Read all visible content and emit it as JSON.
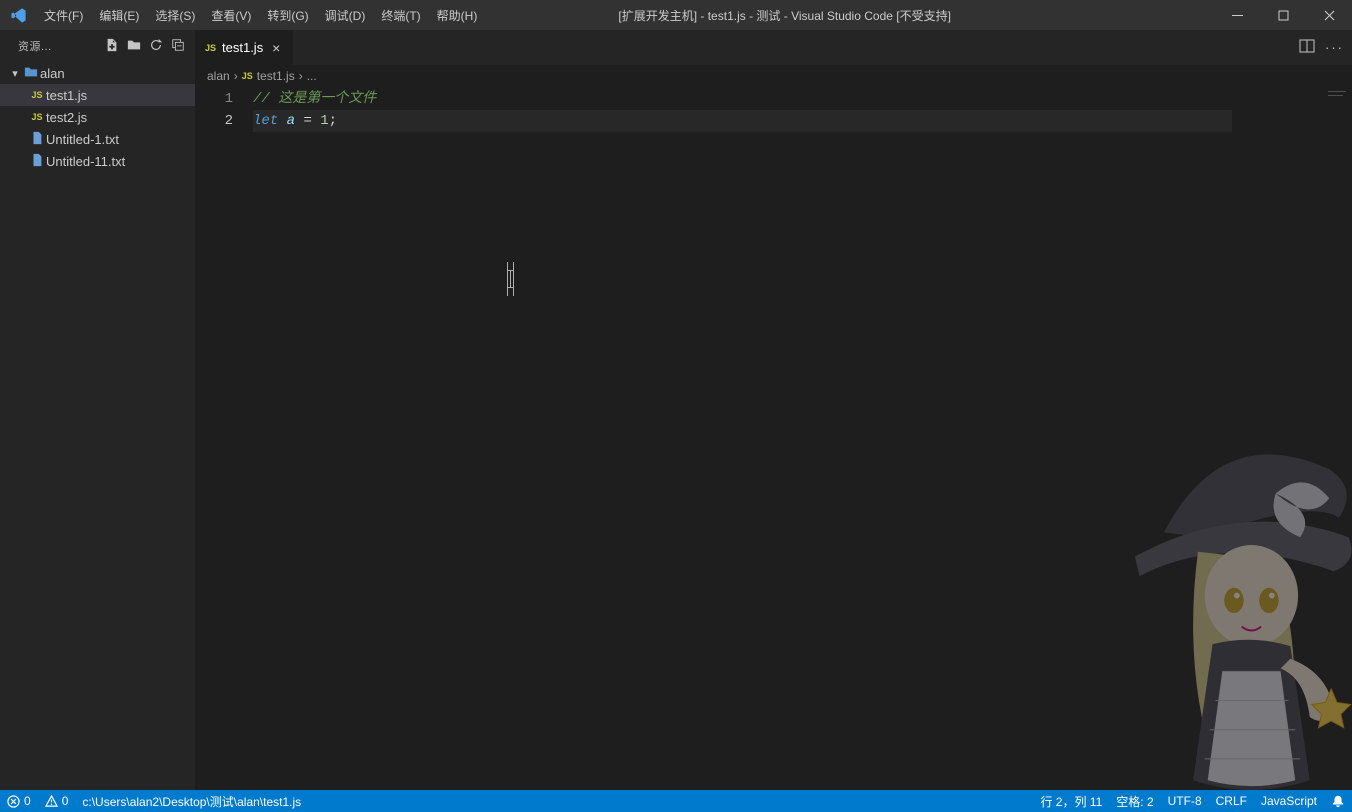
{
  "title": "[扩展开发主机] - test1.js - 测试 - Visual Studio Code [不受支持]",
  "menu": {
    "file": "文件(F)",
    "edit": "编辑(E)",
    "select": "选择(S)",
    "view": "查看(V)",
    "go": "转到(G)",
    "debug": "调试(D)",
    "term": "终端(T)",
    "help": "帮助(H)"
  },
  "explorer": {
    "header": "资源..."
  },
  "tree": {
    "root": {
      "name": "alan"
    },
    "files": [
      {
        "name": "test1.js",
        "icon": "js",
        "selected": true
      },
      {
        "name": "test2.js",
        "icon": "js",
        "selected": false
      },
      {
        "name": "Untitled-1.txt",
        "icon": "file",
        "selected": false
      },
      {
        "name": "Untitled-11.txt",
        "icon": "file",
        "selected": false
      }
    ]
  },
  "tabs": {
    "active": {
      "name": "test1.js"
    }
  },
  "breadcrumb": {
    "root": "alan",
    "file": "test1.js",
    "more": "..."
  },
  "code": {
    "lines": {
      "l1": {
        "no": "1",
        "comment": "// 这是第一个文件"
      },
      "l2": {
        "no": "2",
        "kw": "let",
        "var": "a",
        "eq": "=",
        "num": "1",
        "semi": ";"
      }
    }
  },
  "status": {
    "errors": "0",
    "warnings": "0",
    "path": "c:\\Users\\alan2\\Desktop\\测试\\alan\\test1.js",
    "cursor": "行 2，列 11",
    "spaces": "空格: 2",
    "encoding": "UTF-8",
    "eol": "CRLF",
    "lang": "JavaScript"
  }
}
